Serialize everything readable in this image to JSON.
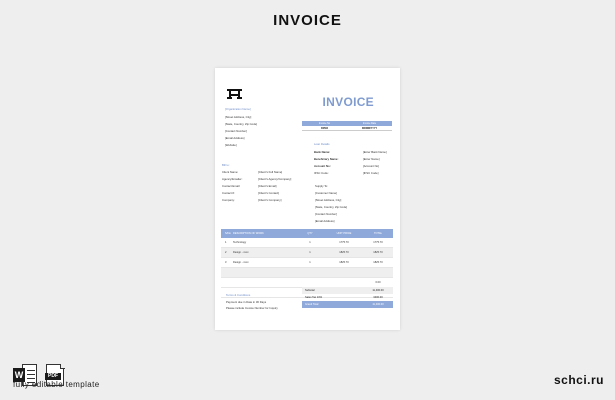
{
  "title": "INVOICE",
  "invoice": {
    "title": "INVOICE",
    "org_name": "[Organization Name]",
    "org_address": [
      "[Street Address, City]",
      "[State, Country, Zip Code]",
      "[Contact Number]",
      "[Email Address]",
      "[Website]"
    ],
    "bill_to_label": "Bill to:",
    "bill_to_fields": [
      {
        "label": "Client Name:",
        "value": "[Client's Full Name]"
      },
      {
        "label": "Agency/Emailer:",
        "value": "[Client's Agency/Company]"
      },
      {
        "label": "Contact Email:",
        "value": "[Client's Email]"
      },
      {
        "label": "Contact #:",
        "value": "[Client's Contact]"
      },
      {
        "label": "Company:",
        "value": "[Client's Company]"
      }
    ],
    "meta_head": [
      "Invoice No",
      "Invoice Date"
    ],
    "meta_vals": [
      "R2584",
      "DD/MM/YYYY"
    ],
    "loan_label": "Loan Details",
    "loan_fields": [
      {
        "label": "Bank Name:",
        "value": "[Enter Bank Name]"
      },
      {
        "label": "Beneficiary Name:",
        "value": "[Enter Name]"
      },
      {
        "label": "Account No:",
        "value": "[Account No]"
      },
      {
        "label": "IFSC Code:",
        "value": "[IFSC Code]"
      }
    ],
    "ship_lines": [
      "Supply To:",
      "[Customer Name]",
      "[Street Address, City]",
      "[State, Country, Zip Code]",
      "[Contact Number]",
      "[Email Address]"
    ],
    "items_head": [
      "S/No",
      "DESCRIPTION OF WORK",
      "QTY",
      "UNIT PRICE",
      "TOTAL"
    ],
    "items": [
      {
        "no": "1",
        "desc": "Technology",
        "qty": "1",
        "price": "1775.70",
        "total": "1775.70"
      },
      {
        "no": "2",
        "desc": "Design - xxxx",
        "qty": "1",
        "price": "1825.70",
        "total": "1825.70"
      },
      {
        "no": "3",
        "desc": "Design - xxxx",
        "qty": "1",
        "price": "1825.70",
        "total": "1825.70"
      },
      {
        "no": "",
        "desc": "",
        "qty": "",
        "price": "",
        "total": ""
      },
      {
        "no": "",
        "desc": "",
        "qty": "",
        "price": "",
        "total": "0.00"
      },
      {
        "no": "",
        "desc": "",
        "qty": "",
        "price": "",
        "total": "0.00"
      }
    ],
    "terms_label": "Terms & Conditions",
    "terms_lines": [
      "Payment due in Date in 30 Days",
      "Please include Invoice Number for Inquiry"
    ],
    "subtotals": [
      {
        "label": "Subtotal",
        "value": "11,400.00"
      },
      {
        "label": "Sales Tax 10%",
        "value": "3400.00"
      },
      {
        "label": "Grand Total",
        "value": "11,400.00"
      }
    ]
  },
  "caption": "fully editable template",
  "brand": "schci.ru",
  "icons": {
    "word": "W",
    "pdf": "PDF"
  }
}
